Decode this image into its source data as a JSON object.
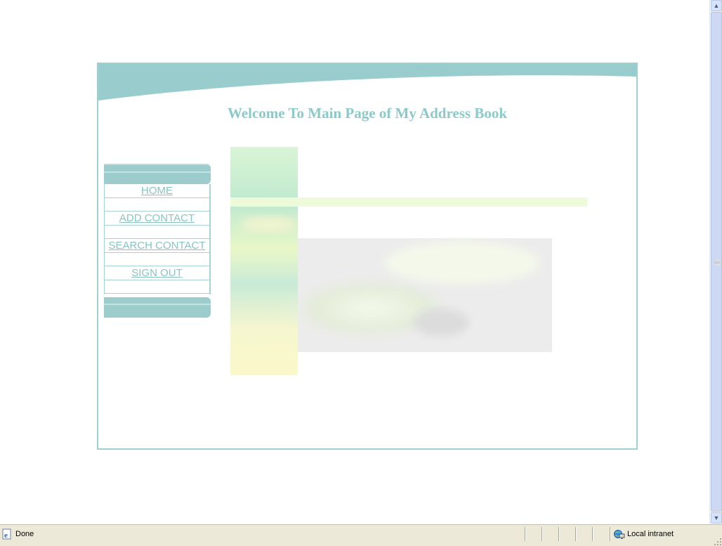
{
  "page": {
    "title": "Welcome To Main Page of My Address Book"
  },
  "nav": {
    "items": [
      {
        "label": "HOME"
      },
      {
        "label": "ADD CONTACT"
      },
      {
        "label": "SEARCH CONTACT"
      },
      {
        "label": "SIGN OUT"
      }
    ]
  },
  "statusbar": {
    "status_text": "Done",
    "zone_text": "Local intranet",
    "browser_icon": "ie-page-icon",
    "zone_icon": "local-intranet-icon"
  },
  "colors": {
    "accent": "#9ccccc",
    "title": "#8ccaca",
    "link": "#88c4c4"
  }
}
